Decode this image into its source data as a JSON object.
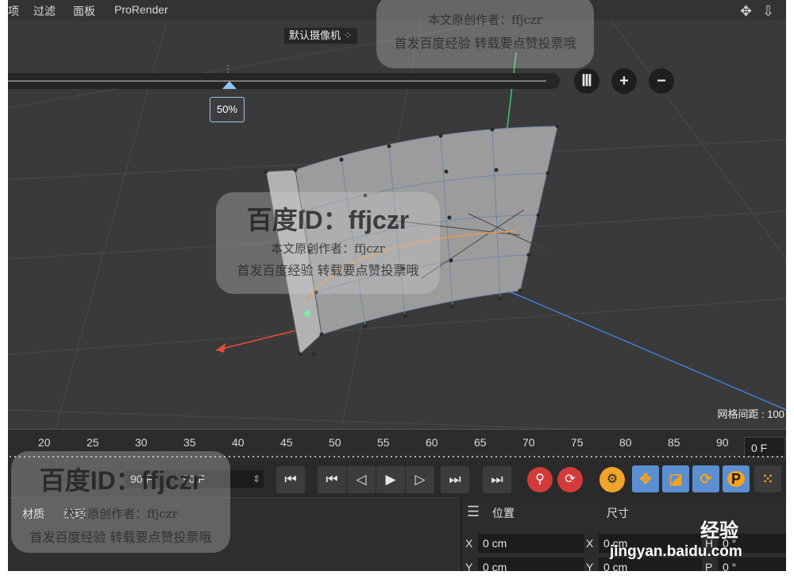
{
  "menu": {
    "items": [
      "项",
      "过滤",
      "面板",
      "ProRender"
    ],
    "corner_icons": [
      "move-view-icon",
      "download-arrow-icon"
    ]
  },
  "viewport": {
    "camera_label": "默认摄像机",
    "camera_icon": "camera-dots-icon",
    "zoom_percent": "50%",
    "zoom_buttons": {
      "columns": "Ⅲ",
      "plus": "+",
      "minus": "−"
    },
    "grid_spacing": "网格间距 : 100",
    "colors": {
      "x_axis": "#e0503a",
      "y_axis": "#3ec86a",
      "z_axis": "#3f7fd8",
      "spline": "#e89a4a",
      "selected_point": "#7ee8a6"
    }
  },
  "timeline": {
    "ticks": [
      "20",
      "25",
      "30",
      "35",
      "40",
      "45",
      "50",
      "55",
      "60",
      "65",
      "70",
      "75",
      "80",
      "85",
      "90"
    ],
    "current_frame": "0 F"
  },
  "transport": {
    "min_frame": "90 F",
    "max_frame": "90 F",
    "buttons": [
      "go-start-icon",
      "prev-key-icon",
      "prev-frame-icon",
      "play-icon",
      "next-frame-icon",
      "next-key-icon",
      "go-end-icon"
    ],
    "record_icons": [
      "key-record-icon",
      "autokey-icon"
    ],
    "tools": [
      "gear-icon",
      "move-icon",
      "scale-icon",
      "rotate-icon",
      "param-icon",
      "dots-grid-icon"
    ],
    "param_label": "P"
  },
  "bottom": {
    "tabs": [
      "材质",
      "纹理"
    ],
    "props": {
      "position_label": "位置",
      "size_label": "尺寸",
      "x_label": "X",
      "y_label": "Y",
      "x_pos": "0 cm",
      "y_pos": "0 cm",
      "x_size": "0 cm",
      "y_size": "0 cm",
      "h_label": "H",
      "p_label": "P",
      "h_val": "0 °",
      "p_val": "0 °"
    }
  },
  "watermarks": {
    "id_text": "百度ID：ffjczr",
    "line1": "本文原创作者：ffjczr",
    "line2": "首发百度经验  转载要点赞投票哦",
    "site": "jingyan.baidu.com",
    "site_cn": "经验"
  }
}
